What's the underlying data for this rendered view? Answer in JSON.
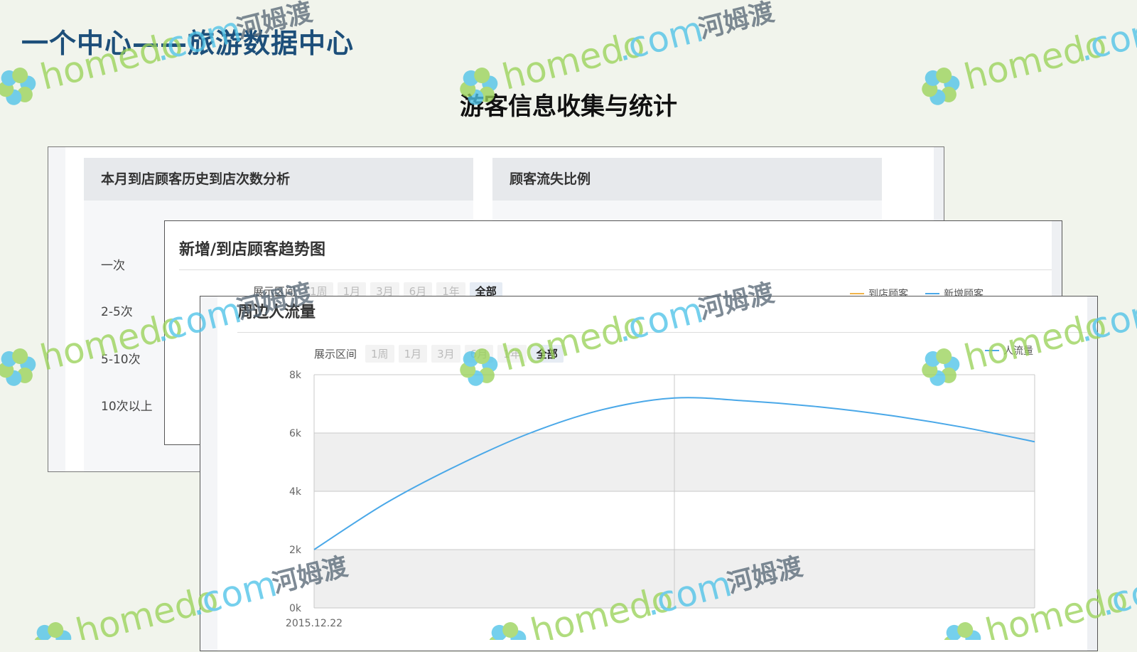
{
  "page": {
    "title": "一个中心——旅游数据中心",
    "subtitle": "游客信息收集与统计"
  },
  "back_panel": {
    "visits_card": {
      "title": "本月到店顾客历史到店次数分析",
      "labels": [
        "一次",
        "2-5次",
        "5-10次",
        "10次以上"
      ]
    },
    "churn_card": {
      "title": "顾客流失比例"
    }
  },
  "mid_panel": {
    "title": "新增/到店顾客趋势图",
    "range_label": "展示区间",
    "range_buttons": [
      "1周",
      "1月",
      "3月",
      "6月",
      "1年",
      "全部"
    ],
    "legend": [
      {
        "name": "到店顾客",
        "color": "#f0b34a"
      },
      {
        "name": "新增顾客",
        "color": "#4aa8e8"
      }
    ]
  },
  "front_panel": {
    "title": "周边人流量",
    "range_label": "展示区间",
    "range_buttons": [
      "1周",
      "1月",
      "3月",
      "6月",
      "1年",
      "全部"
    ],
    "legend": [
      {
        "name": "人流量",
        "color": "#4aa8e8"
      }
    ]
  },
  "chart_data": {
    "type": "line",
    "title": "周边人流量",
    "xlabel": "",
    "ylabel": "",
    "x_tick_labels": [
      "2015.12.22"
    ],
    "y_tick_labels": [
      "0k",
      "2k",
      "4k",
      "6k",
      "8k"
    ],
    "ylim": [
      0,
      8000
    ],
    "grid": true,
    "legend_position": "top-right",
    "series": [
      {
        "name": "人流量",
        "color": "#4aa8e8",
        "x": [
          0,
          0.1,
          0.2,
          0.3,
          0.4,
          0.5,
          0.6,
          0.7,
          0.8,
          0.9,
          1.0
        ],
        "y": [
          2000,
          3600,
          4900,
          6000,
          6800,
          7200,
          7100,
          6900,
          6600,
          6200,
          5700
        ]
      }
    ]
  },
  "watermark": {
    "brand": "homedo",
    "domain": ".com",
    "cn": "河姆渡"
  }
}
